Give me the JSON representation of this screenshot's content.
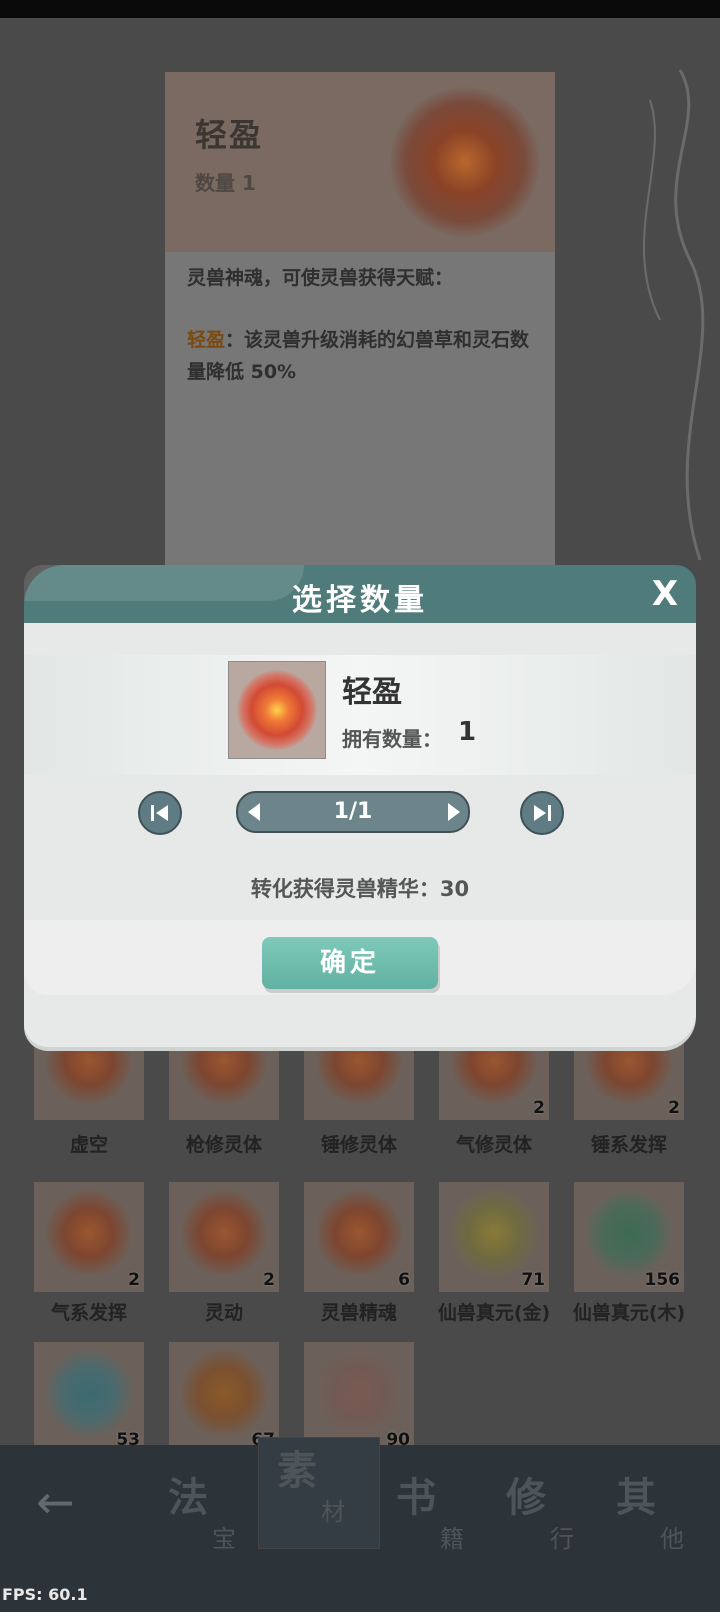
{
  "info_card": {
    "title": "轻盈",
    "quantity": "数量 1",
    "desc_intro": "灵兽神魂，可使灵兽获得天赋：",
    "desc_highlight": "轻盈",
    "desc_body": "：该灵兽升级消耗的幻兽草和灵石数量降低 50%"
  },
  "dialog": {
    "title": "选择数量",
    "close_symbol": "X",
    "item_name": "轻盈",
    "own_label": "拥有数量：",
    "own_value": "1",
    "stepper_value": "1/1",
    "convert_text": "转化获得灵兽精华：30",
    "confirm_label": "确定"
  },
  "inventory": {
    "items": [
      {
        "label": "虚空",
        "count": ""
      },
      {
        "label": "枪修灵体",
        "count": ""
      },
      {
        "label": "锤修灵体",
        "count": ""
      },
      {
        "label": "气修灵体",
        "count": "2"
      },
      {
        "label": "锤系发挥",
        "count": "2"
      },
      {
        "label": "气系发挥",
        "count": "2"
      },
      {
        "label": "灵动",
        "count": "2"
      },
      {
        "label": "灵兽精魂",
        "count": "6"
      },
      {
        "label": "仙兽真元(金)",
        "count": "71"
      },
      {
        "label": "仙兽真元(木)",
        "count": "156"
      },
      {
        "label": "",
        "count": "53"
      },
      {
        "label": "",
        "count": "67"
      },
      {
        "label": "",
        "count": "90"
      }
    ]
  },
  "bottom_nav": {
    "back_icon": "←",
    "tabs": [
      {
        "big": "法",
        "small": "宝"
      },
      {
        "big": "素",
        "small": "材"
      },
      {
        "big": "书",
        "small": "籍"
      },
      {
        "big": "修",
        "small": "行"
      },
      {
        "big": "其",
        "small": "他"
      }
    ]
  },
  "fps": "FPS: 60.1"
}
